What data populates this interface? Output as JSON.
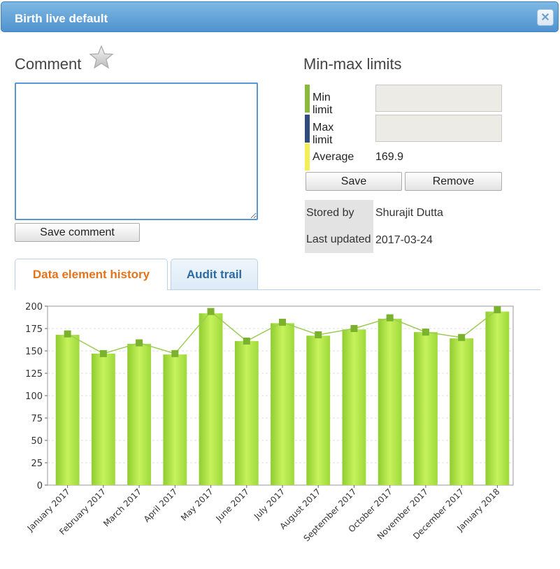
{
  "dialog": {
    "title": "Birth live default"
  },
  "comment": {
    "heading": "Comment",
    "value": "",
    "save_label": "Save comment"
  },
  "minmax": {
    "heading": "Min-max limits",
    "min_label": "Min limit",
    "min_value": "",
    "max_label": "Max limit",
    "max_value": "",
    "avg_label": "Average",
    "avg_value": "169.9",
    "save_label": "Save",
    "remove_label": "Remove",
    "colors": {
      "min": "#8ab93d",
      "max": "#2f4c7c",
      "avg": "#f2ef5b"
    }
  },
  "info": {
    "stored_by_label": "Stored by",
    "stored_by_value": "Shurajit Dutta",
    "last_updated_label": "Last updated",
    "last_updated_value": "2017-03-24"
  },
  "tabs": [
    {
      "label": "Data element history",
      "active": true
    },
    {
      "label": "Audit trail",
      "active": false
    }
  ],
  "icons": {
    "star": "star-icon",
    "close": "close-icon"
  },
  "chart_data": {
    "type": "bar",
    "title": "",
    "xlabel": "",
    "ylabel": "",
    "categories": [
      "January 2017",
      "February 2017",
      "March 2017",
      "April 2017",
      "May 2017",
      "June 2017",
      "July 2017",
      "August 2017",
      "September 2017",
      "October 2017",
      "November 2017",
      "December 2017",
      "January 2018"
    ],
    "values": [
      168,
      147,
      158,
      146,
      192,
      161,
      181,
      167,
      174,
      186,
      171,
      164,
      194
    ],
    "average_line": [
      169,
      147,
      159,
      147,
      194,
      161,
      182,
      168,
      175,
      187,
      171,
      165,
      196
    ],
    "ylim": [
      0,
      200
    ],
    "yticks": [
      0,
      25,
      50,
      75,
      100,
      125,
      150,
      175,
      200
    ],
    "grid": true,
    "colors": {
      "bar": "#a8e04a",
      "line": "#9ccc55",
      "marker": "#7ab22e"
    }
  }
}
